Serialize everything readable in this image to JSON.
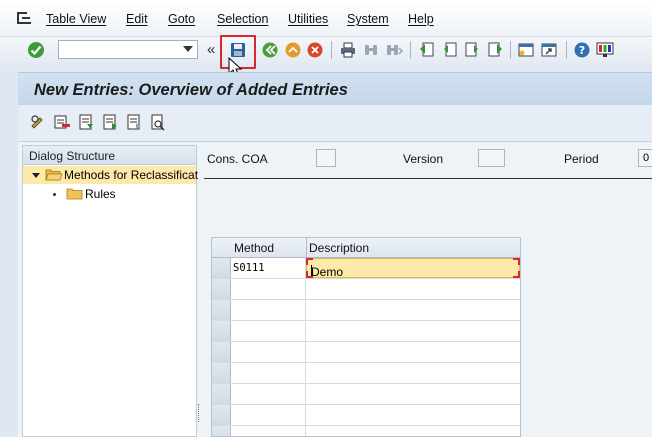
{
  "menu": {
    "items": [
      "Table View",
      "Edit",
      "Goto",
      "Selection",
      "Utilities",
      "System",
      "Help"
    ]
  },
  "toolbar": {
    "command_value": "",
    "icons": [
      "enter-icon",
      "save-icon",
      "back-icon",
      "exit-icon",
      "cancel-icon",
      "print-icon",
      "find-icon",
      "find-next-icon",
      "first-page-icon",
      "previous-page-icon",
      "next-page-icon",
      "last-page-icon",
      "create-session-icon",
      "shortcut-icon",
      "help-icon",
      "layout-icon"
    ]
  },
  "title": "New Entries: Overview of Added Entries",
  "app_toolbar": {
    "icons": [
      "change-display-icon",
      "delete-icon",
      "select-all-icon",
      "select-block-icon",
      "deselect-all-icon",
      "details-icon"
    ]
  },
  "dialog_structure": {
    "header": "Dialog Structure",
    "items": [
      {
        "label": "Methods for Reclassificat",
        "selected": true,
        "expanded": true
      },
      {
        "label": "Rules",
        "selected": false
      }
    ]
  },
  "fields": {
    "cons_coa_label": "Cons. COA",
    "cons_coa_value": "",
    "version_label": "Version",
    "version_value": "",
    "period_label": "Period",
    "period_value": "0"
  },
  "table": {
    "columns": [
      "Method",
      "Description"
    ],
    "rows": [
      {
        "method": "S0111",
        "description": "Demo"
      },
      {
        "method": "",
        "description": ""
      },
      {
        "method": "",
        "description": ""
      },
      {
        "method": "",
        "description": ""
      },
      {
        "method": "",
        "description": ""
      },
      {
        "method": "",
        "description": ""
      },
      {
        "method": "",
        "description": ""
      },
      {
        "method": "",
        "description": ""
      },
      {
        "method": "",
        "description": ""
      }
    ]
  },
  "colors": {
    "highlight": "#d9272e",
    "selected_row": "#fde9a9",
    "title_bar": "#c8daed"
  }
}
